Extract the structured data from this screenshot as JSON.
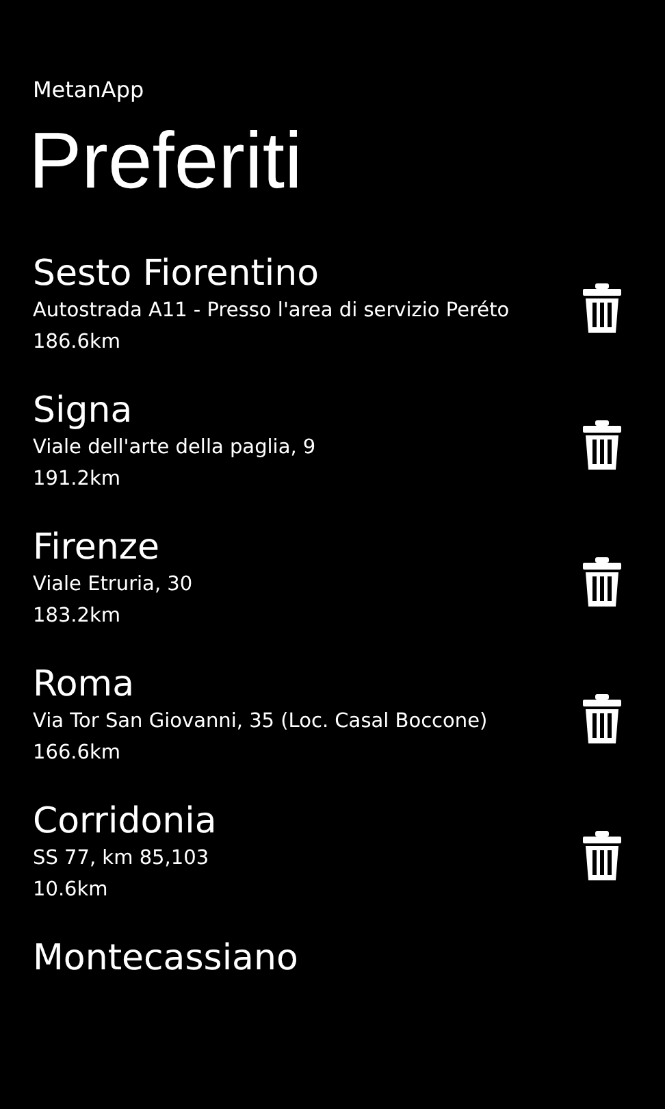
{
  "app_title": "MetanApp",
  "page_title": "Preferiti",
  "favorites": [
    {
      "name": "Sesto Fiorentino",
      "address": "Autostrada A11 - Presso l'area di servizio Peréto",
      "distance": "186.6km"
    },
    {
      "name": "Signa",
      "address": "Viale dell'arte della paglia, 9",
      "distance": "191.2km"
    },
    {
      "name": "Firenze",
      "address": "Viale Etruria, 30",
      "distance": "183.2km"
    },
    {
      "name": "Roma",
      "address": "Via Tor San Giovanni, 35 (Loc. Casal Boccone)",
      "distance": "166.6km"
    },
    {
      "name": "Corridonia",
      "address": "SS 77, km 85,103",
      "distance": "10.6km"
    },
    {
      "name": "Montecassiano"
    }
  ]
}
